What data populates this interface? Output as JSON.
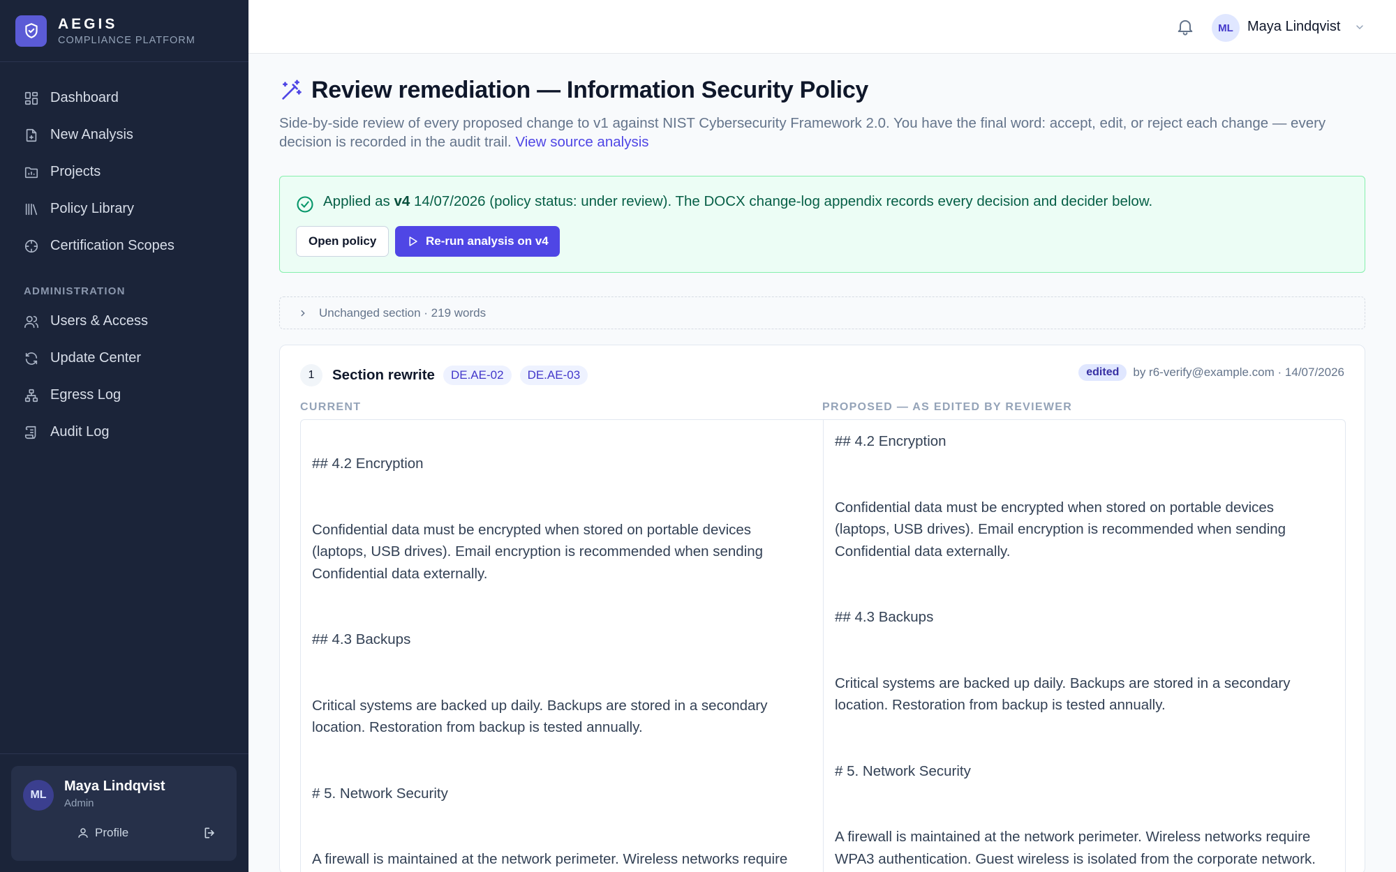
{
  "brand": {
    "name": "AEGIS",
    "subtitle": "COMPLIANCE PLATFORM"
  },
  "sidebar": {
    "nav": [
      {
        "label": "Dashboard",
        "icon": "dashboard-icon"
      },
      {
        "label": "New Analysis",
        "icon": "file-plus-icon"
      },
      {
        "label": "Projects",
        "icon": "folder-chart-icon"
      },
      {
        "label": "Policy Library",
        "icon": "library-icon"
      },
      {
        "label": "Certification Scopes",
        "icon": "scope-icon"
      }
    ],
    "admin_heading": "ADMINISTRATION",
    "admin_nav": [
      {
        "label": "Users & Access",
        "icon": "users-icon"
      },
      {
        "label": "Update Center",
        "icon": "refresh-icon"
      },
      {
        "label": "Egress Log",
        "icon": "network-icon"
      },
      {
        "label": "Audit Log",
        "icon": "scroll-icon"
      }
    ],
    "user": {
      "initials": "ML",
      "name": "Maya Lindqvist",
      "role": "Admin",
      "profile_label": "Profile"
    }
  },
  "topbar": {
    "initials": "ML",
    "user_name": "Maya Lindqvist"
  },
  "page": {
    "title": "Review remediation — Information Security Policy",
    "subtitle": "Side-by-side review of every proposed change to v1 against NIST Cybersecurity Framework 2.0. You have the final word: accept, edit, or reject each change — every decision is recorded in the audit trail.",
    "source_link": "View source analysis"
  },
  "banner": {
    "prefix": "Applied as ",
    "version": "v4",
    "suffix": " 14/07/2026 (policy status: under review). The DOCX change-log appendix records every decision and decider below.",
    "open_label": "Open policy",
    "rerun_label": "Re-run analysis on v4"
  },
  "unchanged": {
    "label": "Unchanged section · 219 words"
  },
  "change": {
    "number": "1",
    "title": "Section rewrite",
    "tags": [
      "DE.AE-02",
      "DE.AE-03"
    ],
    "status": "edited",
    "meta": "by r6-verify@example.com · 14/07/2026",
    "current_label": "CURRENT",
    "proposed_label": "PROPOSED — AS EDITED BY REVIEWER",
    "current": [
      "## 4.2 Encryption",
      "Confidential data must be encrypted when stored on portable devices (laptops, USB drives). Email encryption is recommended when sending Confidential data externally.",
      "## 4.3 Backups",
      "Critical systems are backed up daily. Backups are stored in a secondary location. Restoration from backup is tested annually.",
      "# 5. Network Security",
      "A firewall is maintained at the network perimeter. Wireless networks require"
    ],
    "proposed": [
      "## 4.2 Encryption",
      "Confidential data must be encrypted when stored on portable devices (laptops, USB drives). Email encryption is recommended when sending Confidential data externally.",
      "## 4.3 Backups",
      "Critical systems are backed up daily. Backups are stored in a secondary location. Restoration from backup is tested annually.",
      "# 5. Network Security",
      "A firewall is maintained at the network perimeter. Wireless networks require WPA3 authentication. Guest wireless is isolated from the corporate network."
    ]
  }
}
